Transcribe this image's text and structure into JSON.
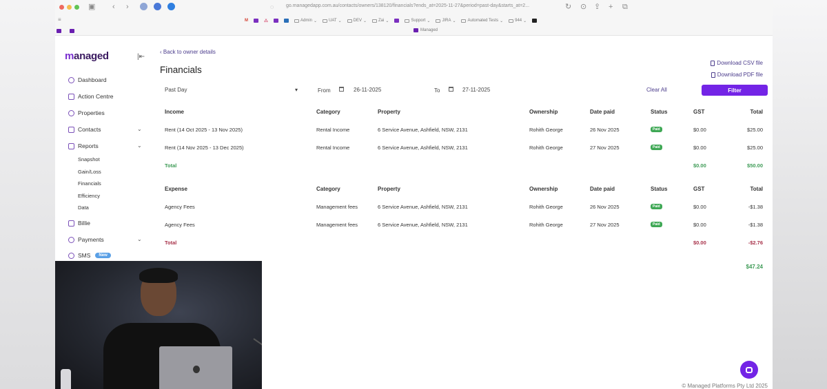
{
  "browser": {
    "url": "go.managedapp.com.au/contacts/owners/138120/financials?ends_at=2025-11-27&period=past-day&starts_at=2...",
    "bookmarks": [
      {
        "label": "Admin"
      },
      {
        "label": "UAT"
      },
      {
        "label": "DEV"
      },
      {
        "label": "Zai"
      },
      {
        "label": "Support"
      },
      {
        "label": "JIRA"
      },
      {
        "label": "Automated Tests"
      },
      {
        "label": "944"
      }
    ],
    "tab_title": "Managed"
  },
  "sidebar": {
    "brand": "managed",
    "items": [
      {
        "label": "Dashboard"
      },
      {
        "label": "Action Centre"
      },
      {
        "label": "Properties"
      },
      {
        "label": "Contacts"
      },
      {
        "label": "Reports"
      },
      {
        "label": "Billie"
      },
      {
        "label": "Payments"
      },
      {
        "label": "SMS",
        "badge": "New"
      }
    ],
    "reports_sub": [
      {
        "label": "Snapshot"
      },
      {
        "label": "Gain/Loss"
      },
      {
        "label": "Financials"
      },
      {
        "label": "Efficiency"
      },
      {
        "label": "Data"
      }
    ]
  },
  "main": {
    "back_link": "Back to owner details",
    "title": "Financials",
    "download_csv": "Download CSV file",
    "download_pdf": "Download PDF file",
    "filters": {
      "period": "Past Day",
      "from_label": "From",
      "from_value": "26-11-2025",
      "to_label": "To",
      "to_value": "27-11-2025",
      "clear_all": "Clear All",
      "filter_button": "Filter"
    },
    "income": {
      "headers": [
        "Income",
        "Category",
        "Property",
        "Ownership",
        "Date paid",
        "Status",
        "GST",
        "Total"
      ],
      "rows": [
        {
          "desc": "Rent (14 Oct 2025 - 13 Nov 2025)",
          "category": "Rental Income",
          "property": "6 Service Avenue, Ashfield, NSW, 2131",
          "ownership": "Rohith George",
          "date": "26 Nov 2025",
          "status": "Paid",
          "gst": "$0.00",
          "total": "$25.00"
        },
        {
          "desc": "Rent (14 Nov 2025 - 13 Dec 2025)",
          "category": "Rental Income",
          "property": "6 Service Avenue, Ashfield, NSW, 2131",
          "ownership": "Rohith George",
          "date": "27 Nov 2025",
          "status": "Paid",
          "gst": "$0.00",
          "total": "$25.00"
        }
      ],
      "total_label": "Total",
      "total_gst": "$0.00",
      "total_amount": "$50.00"
    },
    "expense": {
      "headers": [
        "Expense",
        "Category",
        "Property",
        "Ownership",
        "Date paid",
        "Status",
        "GST",
        "Total"
      ],
      "rows": [
        {
          "desc": "Agency Fees",
          "category": "Management fees",
          "property": "6 Service Avenue, Ashfield, NSW, 2131",
          "ownership": "Rohith George",
          "date": "26 Nov 2025",
          "status": "Paid",
          "gst": "$0.00",
          "total": "-$1.38"
        },
        {
          "desc": "Agency Fees",
          "category": "Management fees",
          "property": "6 Service Avenue, Ashfield, NSW, 2131",
          "ownership": "Rohith George",
          "date": "27 Nov 2025",
          "status": "Paid",
          "gst": "$0.00",
          "total": "-$1.38"
        }
      ],
      "total_label": "Total",
      "total_gst": "$0.00",
      "total_amount": "-$2.76"
    },
    "net_total": "$47.24"
  },
  "footer": "© Managed Platforms Pty Ltd 2025",
  "colors": {
    "accent": "#7324e6",
    "link": "#4b3c8c",
    "positive": "#3e9b56",
    "negative": "#a8324a",
    "paid_badge": "#3fa855"
  }
}
